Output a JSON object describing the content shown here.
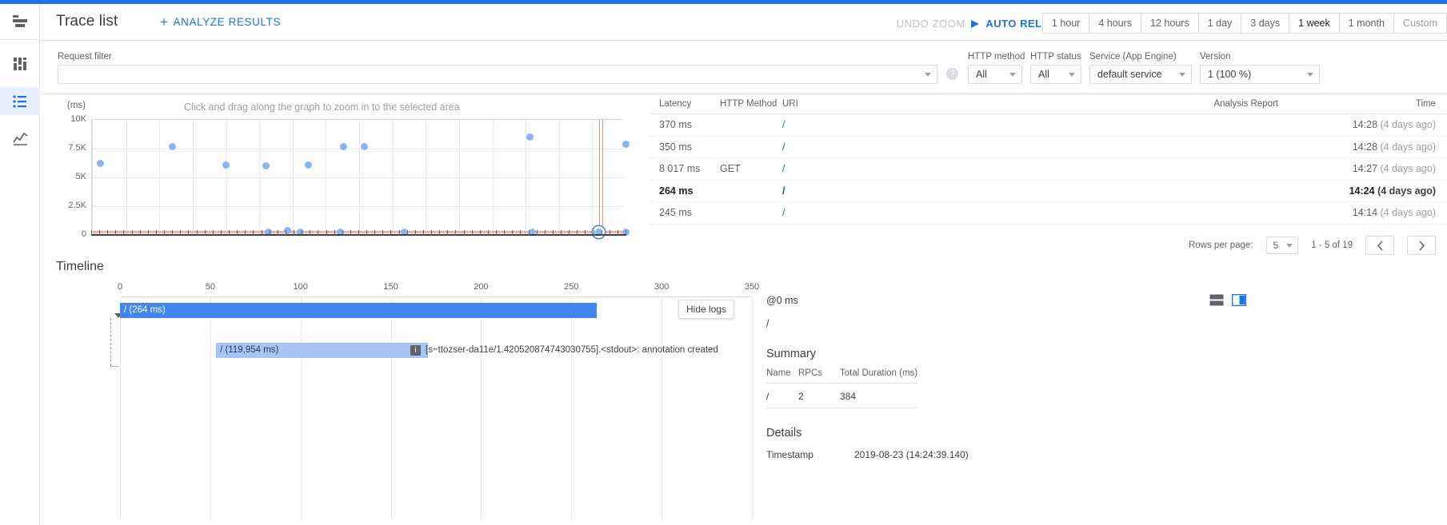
{
  "app": {
    "title": "Trace list",
    "analyze_label": "ANALYZE RESULTS",
    "undo_zoom_label": "UNDO ZOOM",
    "auto_reload_label": "AUTO RELOAD",
    "accent_color": "#1a73e8"
  },
  "time_ranges": [
    {
      "label": "1 hour",
      "selected": false
    },
    {
      "label": "4 hours",
      "selected": false
    },
    {
      "label": "12 hours",
      "selected": false
    },
    {
      "label": "1 day",
      "selected": false
    },
    {
      "label": "3 days",
      "selected": false
    },
    {
      "label": "1 week",
      "selected": true
    },
    {
      "label": "1 month",
      "selected": false
    },
    {
      "label": "Custom",
      "selected": false
    }
  ],
  "filters": {
    "request_filter_label": "Request filter",
    "request_filter_value": "",
    "help_icon": "?",
    "http_method": {
      "label": "HTTP method",
      "value": "All"
    },
    "http_status": {
      "label": "HTTP status",
      "value": "All"
    },
    "service": {
      "label": "Service (App Engine)",
      "value": "default service"
    },
    "version": {
      "label": "Version",
      "value": "1 (100 %)"
    }
  },
  "chart_data": {
    "type": "scatter",
    "title": "",
    "hint": "Click and drag along the graph to zoom in to the selected area",
    "ylabel": "(ms)",
    "xlabel": "",
    "ylim": [
      0,
      10000
    ],
    "yticks": [
      {
        "label": "10K",
        "value": 10000
      },
      {
        "label": "7.5K",
        "value": 7500
      },
      {
        "label": "5K",
        "value": 5000
      },
      {
        "label": "2.5K",
        "value": 2500
      },
      {
        "label": "0",
        "value": 0
      }
    ],
    "grid": true,
    "threshold_line": {
      "value": 300,
      "color": "#f2a197"
    },
    "marker_line": {
      "x_pct": 95.0,
      "color": "#d93025"
    },
    "points": [
      {
        "x_pct": 1.5,
        "y": 6250,
        "selected": false
      },
      {
        "x_pct": 15.0,
        "y": 7650,
        "selected": false
      },
      {
        "x_pct": 25.0,
        "y": 6100,
        "selected": false
      },
      {
        "x_pct": 32.5,
        "y": 6000,
        "selected": false
      },
      {
        "x_pct": 40.5,
        "y": 6050,
        "selected": false
      },
      {
        "x_pct": 47.0,
        "y": 7700,
        "selected": false
      },
      {
        "x_pct": 51.0,
        "y": 7650,
        "selected": false
      },
      {
        "x_pct": 82.0,
        "y": 8500,
        "selected": false
      },
      {
        "x_pct": 100.0,
        "y": 7900,
        "selected": false
      },
      {
        "x_pct": 33.0,
        "y": 260,
        "selected": false
      },
      {
        "x_pct": 36.5,
        "y": 380,
        "selected": false
      },
      {
        "x_pct": 39.0,
        "y": 250,
        "selected": false
      },
      {
        "x_pct": 46.5,
        "y": 270,
        "selected": false
      },
      {
        "x_pct": 58.5,
        "y": 240,
        "selected": false
      },
      {
        "x_pct": 82.5,
        "y": 250,
        "selected": false
      },
      {
        "x_pct": 95.0,
        "y": 264,
        "selected": true
      },
      {
        "x_pct": 100.0,
        "y": 260,
        "selected": false
      }
    ]
  },
  "table": {
    "columns": [
      "Latency",
      "HTTP Method",
      "URI",
      "Analysis Report",
      "Time"
    ],
    "rows": [
      {
        "latency": "370 ms",
        "method": "",
        "uri": "/",
        "report": "",
        "time": "14:28",
        "ago": "(4 days ago)",
        "active": false
      },
      {
        "latency": "350 ms",
        "method": "",
        "uri": "/",
        "report": "",
        "time": "14:28",
        "ago": "(4 days ago)",
        "active": false
      },
      {
        "latency": "8 017 ms",
        "method": "GET",
        "uri": "/",
        "report": "",
        "time": "14:27",
        "ago": "(4 days ago)",
        "active": false
      },
      {
        "latency": "264 ms",
        "method": "",
        "uri": "/",
        "report": "",
        "time": "14:24",
        "ago": "(4 days ago)",
        "active": true
      },
      {
        "latency": "245 ms",
        "method": "",
        "uri": "/",
        "report": "",
        "time": "14:14",
        "ago": "(4 days ago)",
        "active": false
      }
    ],
    "pagination": {
      "rows_per_page_label": "Rows per page:",
      "rows_per_page_value": "5",
      "range_label": "1 - 5 of 19",
      "prev_icon": "‹",
      "next_icon": "›"
    }
  },
  "timeline": {
    "title": "Timeline",
    "ticks": [
      "0",
      "50",
      "100",
      "150",
      "200",
      "250",
      "300",
      "350"
    ],
    "hide_logs_label": "Hide logs",
    "bars": [
      {
        "label": "/ (264 ms)",
        "left_pct": 0,
        "width_pct": 75.5,
        "child": false
      },
      {
        "label": "/ (119,954 ms)",
        "left_pct": 15.2,
        "width_pct": 33.5,
        "child": true
      }
    ],
    "annotation": {
      "icon": "i",
      "text": "[s~ttozser-da11e/1.420520874743030755].<stdout>: annotation created"
    }
  },
  "details": {
    "at_label": "@0 ms",
    "uri": "/",
    "summary_title": "Summary",
    "summary_columns": [
      "Name",
      "RPCs",
      "Total Duration (ms)"
    ],
    "summary_rows": [
      {
        "name": "/",
        "rpcs": "2",
        "duration": "384"
      }
    ],
    "details_title": "Details",
    "detail_rows": [
      {
        "key": "Timestamp",
        "value": "2019-08-23 (14:24:39.140)"
      }
    ]
  },
  "rail": {
    "items": [
      {
        "name": "menu-icon",
        "active": false
      },
      {
        "name": "dashboard-icon",
        "active": false
      },
      {
        "name": "trace-list-icon",
        "active": true
      },
      {
        "name": "analytics-icon",
        "active": false
      }
    ]
  }
}
